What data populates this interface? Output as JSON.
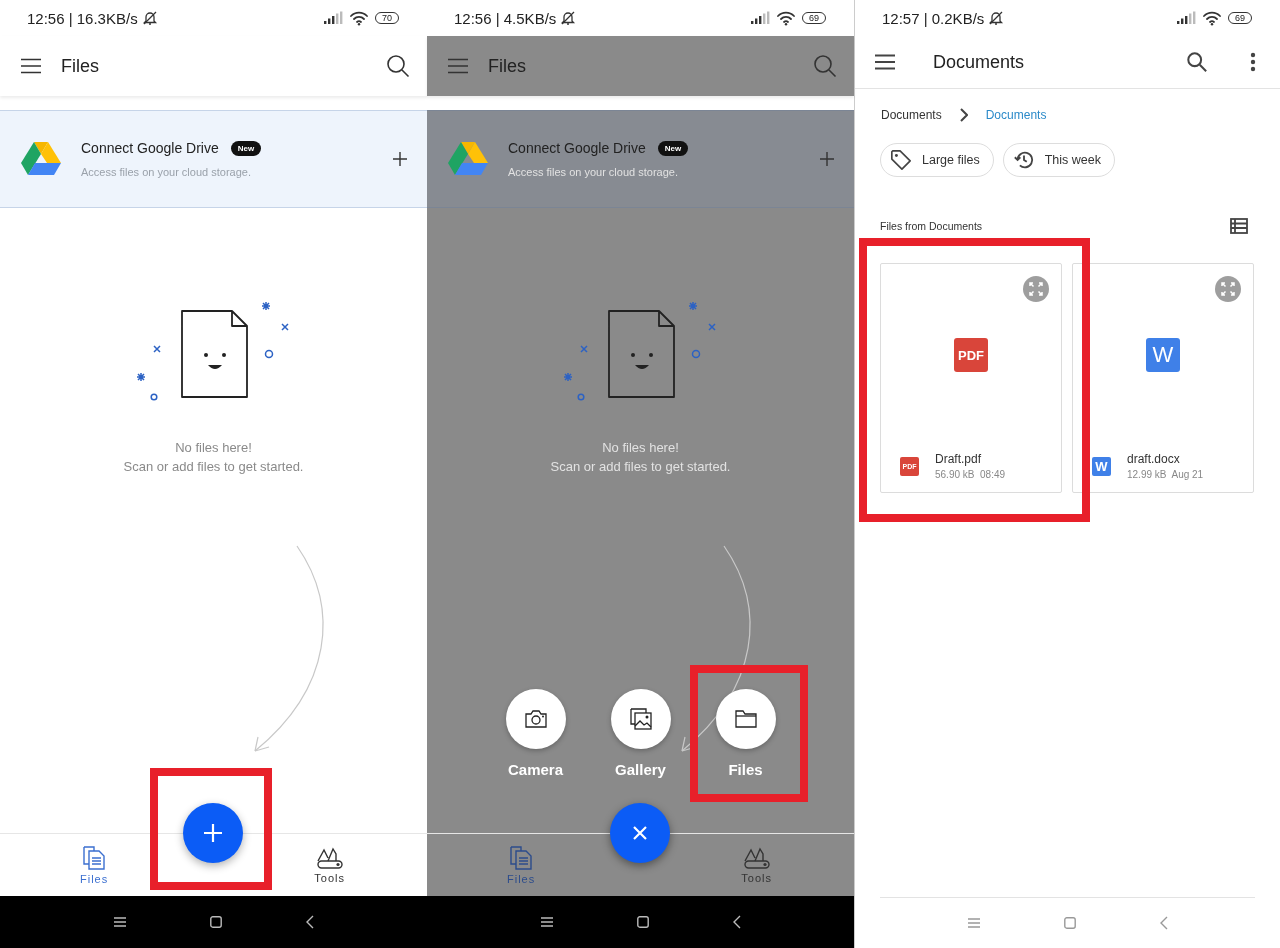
{
  "panels": [
    {
      "kind": "home",
      "status": {
        "time": "12:56 | 16.3KB/s",
        "battery": "70"
      },
      "title": "Files",
      "drive_card": {
        "title": "Connect Google Drive",
        "badge": "New",
        "subtitle": "Access files on your cloud storage."
      },
      "empty_title": "No files here!",
      "empty_hint": "Scan or add files to get started.",
      "menu_open": false,
      "fab": {
        "highlighted": true
      },
      "nav": [
        {
          "kind": "files",
          "label": "Files",
          "selected": true
        },
        {
          "kind": "tools",
          "label": "Tools",
          "selected": false
        }
      ]
    },
    {
      "kind": "home",
      "status": {
        "time": "12:56 | 4.5KB/s",
        "battery": "69"
      },
      "title": "Files",
      "drive_card": {
        "title": "Connect Google Drive",
        "badge": "New",
        "subtitle": "Access files on your cloud storage."
      },
      "empty_title": "No files here!",
      "empty_hint": "Scan or add files to get started.",
      "menu_open": true,
      "fab": {
        "highlighted": false
      },
      "actions": [
        {
          "kind": "camera",
          "label": "Camera",
          "highlighted": false
        },
        {
          "kind": "gallery",
          "label": "Gallery",
          "highlighted": false
        },
        {
          "kind": "files",
          "label": "Files",
          "highlighted": true
        }
      ],
      "nav": [
        {
          "kind": "files",
          "label": "Files",
          "selected": true
        },
        {
          "kind": "tools",
          "label": "Tools",
          "selected": false
        }
      ]
    },
    {
      "kind": "folder",
      "status": {
        "time": "12:57 | 0.2KB/s",
        "battery": "69"
      },
      "title": "Documents",
      "breadcrumb": [
        {
          "label": "Documents",
          "selected": false
        },
        {
          "label": "Documents",
          "selected": true
        }
      ],
      "chips": [
        {
          "kind": "tag",
          "label": "Large files"
        },
        {
          "kind": "history",
          "label": "This week"
        }
      ],
      "section_title": "Files from Documents",
      "files": [
        {
          "kind": "pdf",
          "badge": "PDF",
          "small_badge": "PDF",
          "name": "Draft.pdf",
          "meta": "56.90 kB  08:49",
          "highlighted": true
        },
        {
          "kind": "word",
          "badge": "W",
          "small_badge": "W",
          "name": "draft.docx",
          "meta": "12.99 kB  Aug 21",
          "highlighted": false
        }
      ]
    }
  ]
}
